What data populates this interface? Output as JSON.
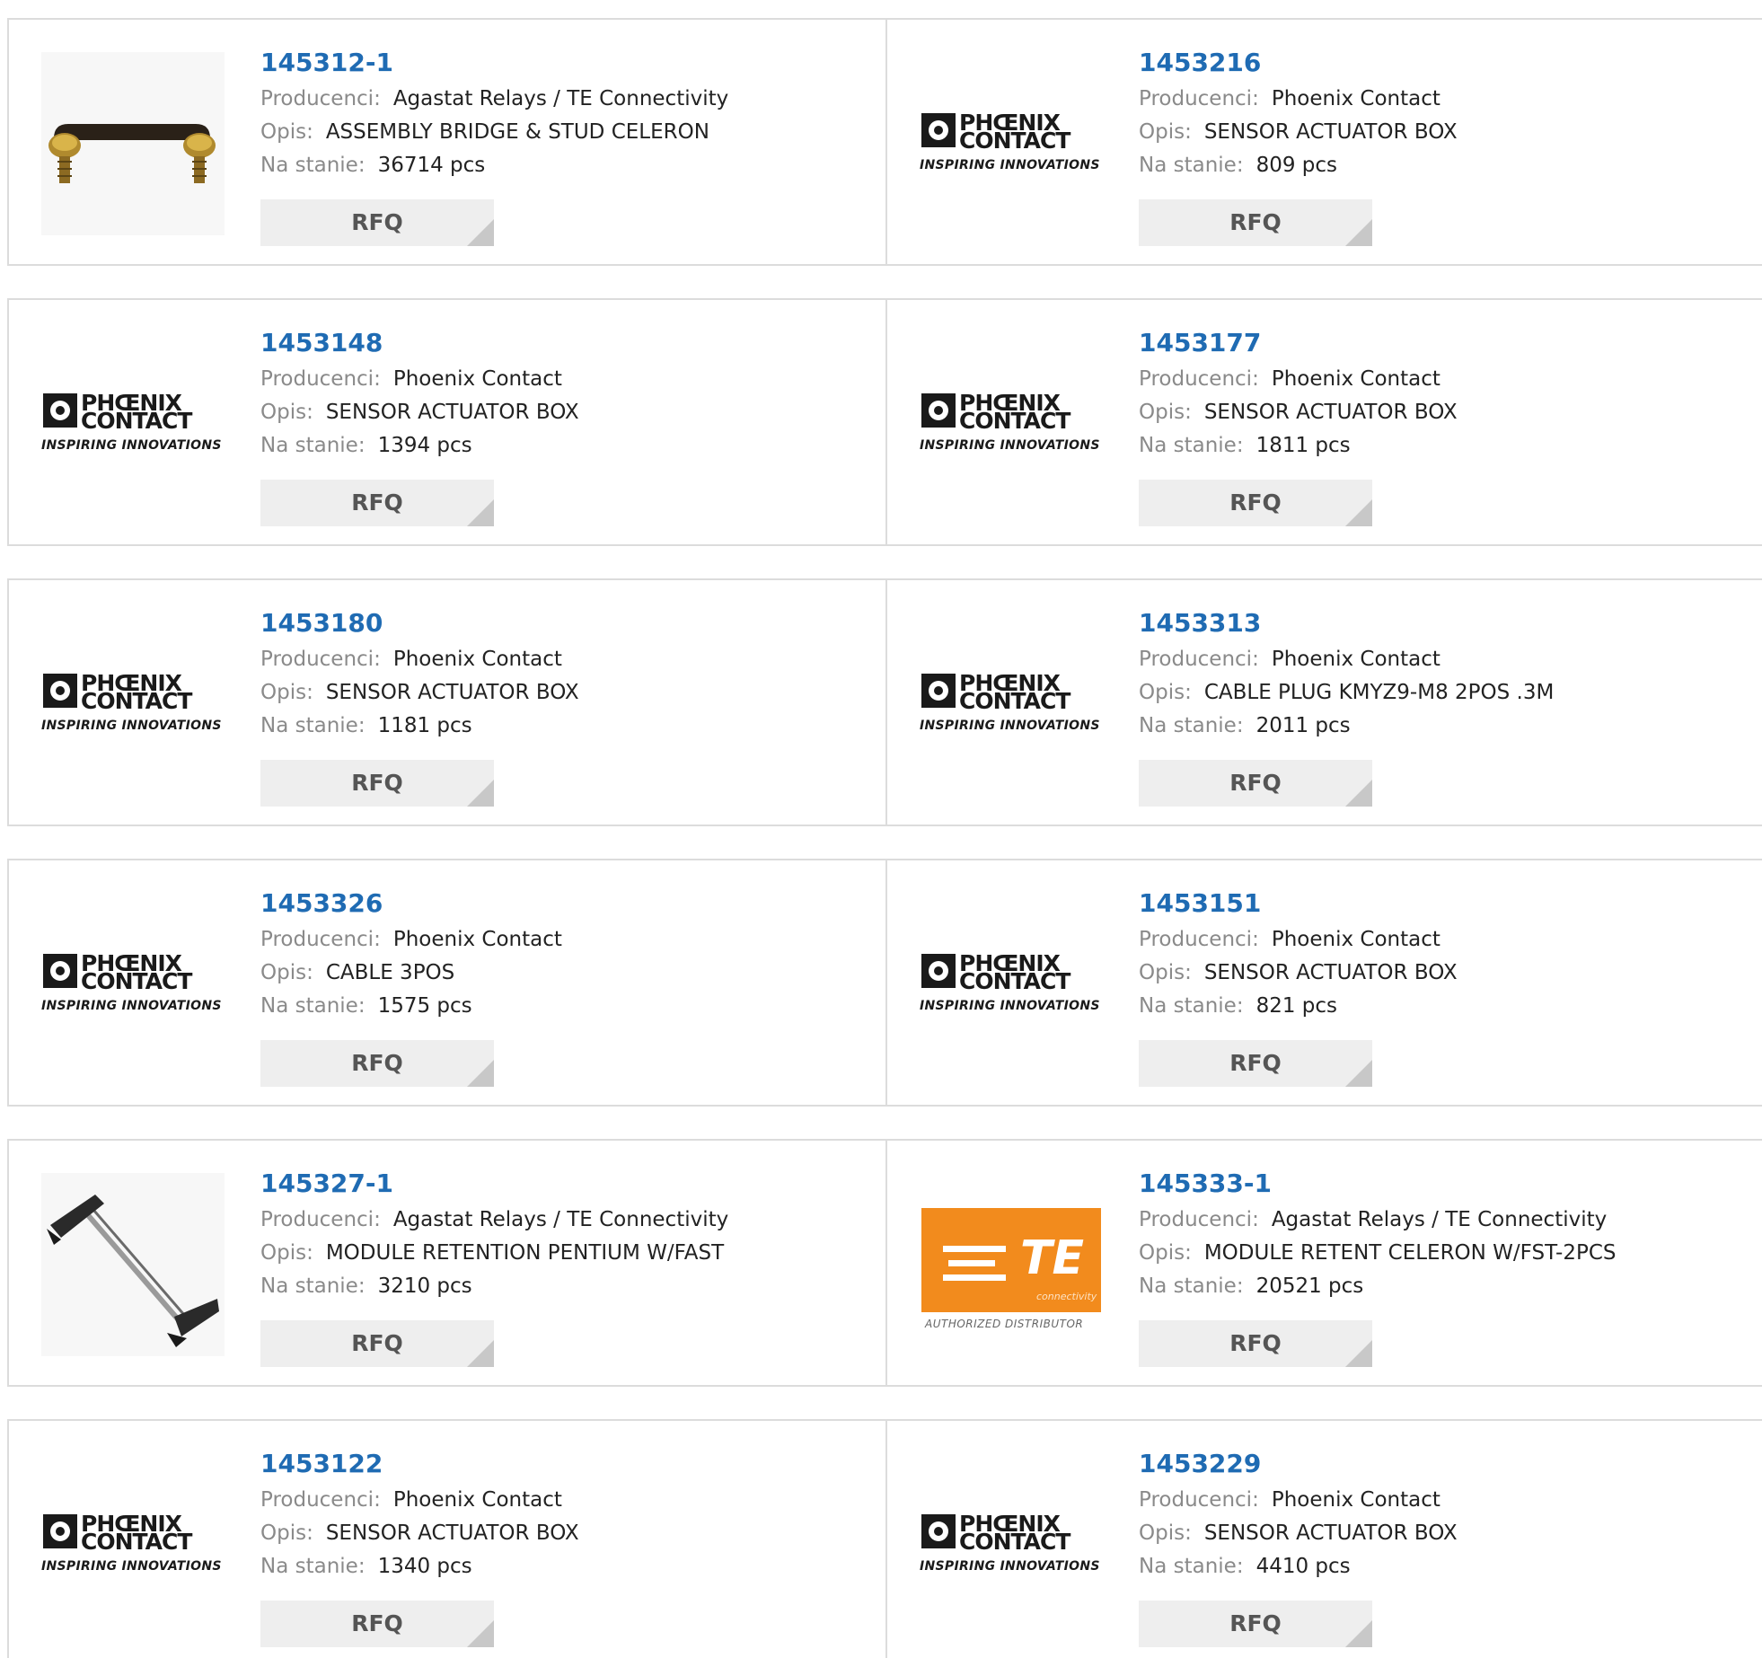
{
  "labels": {
    "manufacturer": "Producenci:",
    "description": "Opis:",
    "stock": "Na stanie:",
    "rfq": "RFQ"
  },
  "logo_text": {
    "phoenix_line1": "PHŒNIX",
    "phoenix_line2": "CONTACT",
    "phoenix_tagline": "INSPIRING INNOVATIONS",
    "te_mark": "TE",
    "te_sub": "connectivity",
    "te_tagline": "AUTHORIZED DISTRIBUTOR"
  },
  "colors": {
    "part_link": "#1f6bb3",
    "card_border": "#dcdcdc",
    "rfq_bg": "#eeeeee",
    "te_orange": "#f28b1d"
  },
  "products": [
    {
      "part": "145312-1",
      "manufacturer": "Agastat Relays / TE Connectivity",
      "description": "ASSEMBLY BRIDGE & STUD CELERON",
      "stock": "36714 pcs",
      "image": "assembly-bridge-photo"
    },
    {
      "part": "1453216",
      "manufacturer": "Phoenix Contact",
      "description": "SENSOR ACTUATOR BOX",
      "stock": "809 pcs",
      "image": "phoenix-contact-logo"
    },
    {
      "part": "1453148",
      "manufacturer": "Phoenix Contact",
      "description": "SENSOR ACTUATOR BOX",
      "stock": "1394 pcs",
      "image": "phoenix-contact-logo"
    },
    {
      "part": "1453177",
      "manufacturer": "Phoenix Contact",
      "description": "SENSOR ACTUATOR BOX",
      "stock": "1811 pcs",
      "image": "phoenix-contact-logo"
    },
    {
      "part": "1453180",
      "manufacturer": "Phoenix Contact",
      "description": "SENSOR ACTUATOR BOX",
      "stock": "1181 pcs",
      "image": "phoenix-contact-logo"
    },
    {
      "part": "1453313",
      "manufacturer": "Phoenix Contact",
      "description": "CABLE PLUG KMYZ9-M8 2POS .3M",
      "stock": "2011 pcs",
      "image": "phoenix-contact-logo"
    },
    {
      "part": "1453326",
      "manufacturer": "Phoenix Contact",
      "description": "CABLE 3POS",
      "stock": "1575 pcs",
      "image": "phoenix-contact-logo"
    },
    {
      "part": "1453151",
      "manufacturer": "Phoenix Contact",
      "description": "SENSOR ACTUATOR BOX",
      "stock": "821 pcs",
      "image": "phoenix-contact-logo"
    },
    {
      "part": "145327-1",
      "manufacturer": "Agastat Relays / TE Connectivity",
      "description": "MODULE RETENTION PENTIUM W/FAST",
      "stock": "3210 pcs",
      "image": "module-retention-photo"
    },
    {
      "part": "145333-1",
      "manufacturer": "Agastat Relays / TE Connectivity",
      "description": "MODULE RETENT CELERON W/FST-2PCS",
      "stock": "20521 pcs",
      "image": "te-connectivity-logo"
    },
    {
      "part": "1453122",
      "manufacturer": "Phoenix Contact",
      "description": "SENSOR ACTUATOR BOX",
      "stock": "1340 pcs",
      "image": "phoenix-contact-logo"
    },
    {
      "part": "1453229",
      "manufacturer": "Phoenix Contact",
      "description": "SENSOR ACTUATOR BOX",
      "stock": "4410 pcs",
      "image": "phoenix-contact-logo"
    }
  ]
}
